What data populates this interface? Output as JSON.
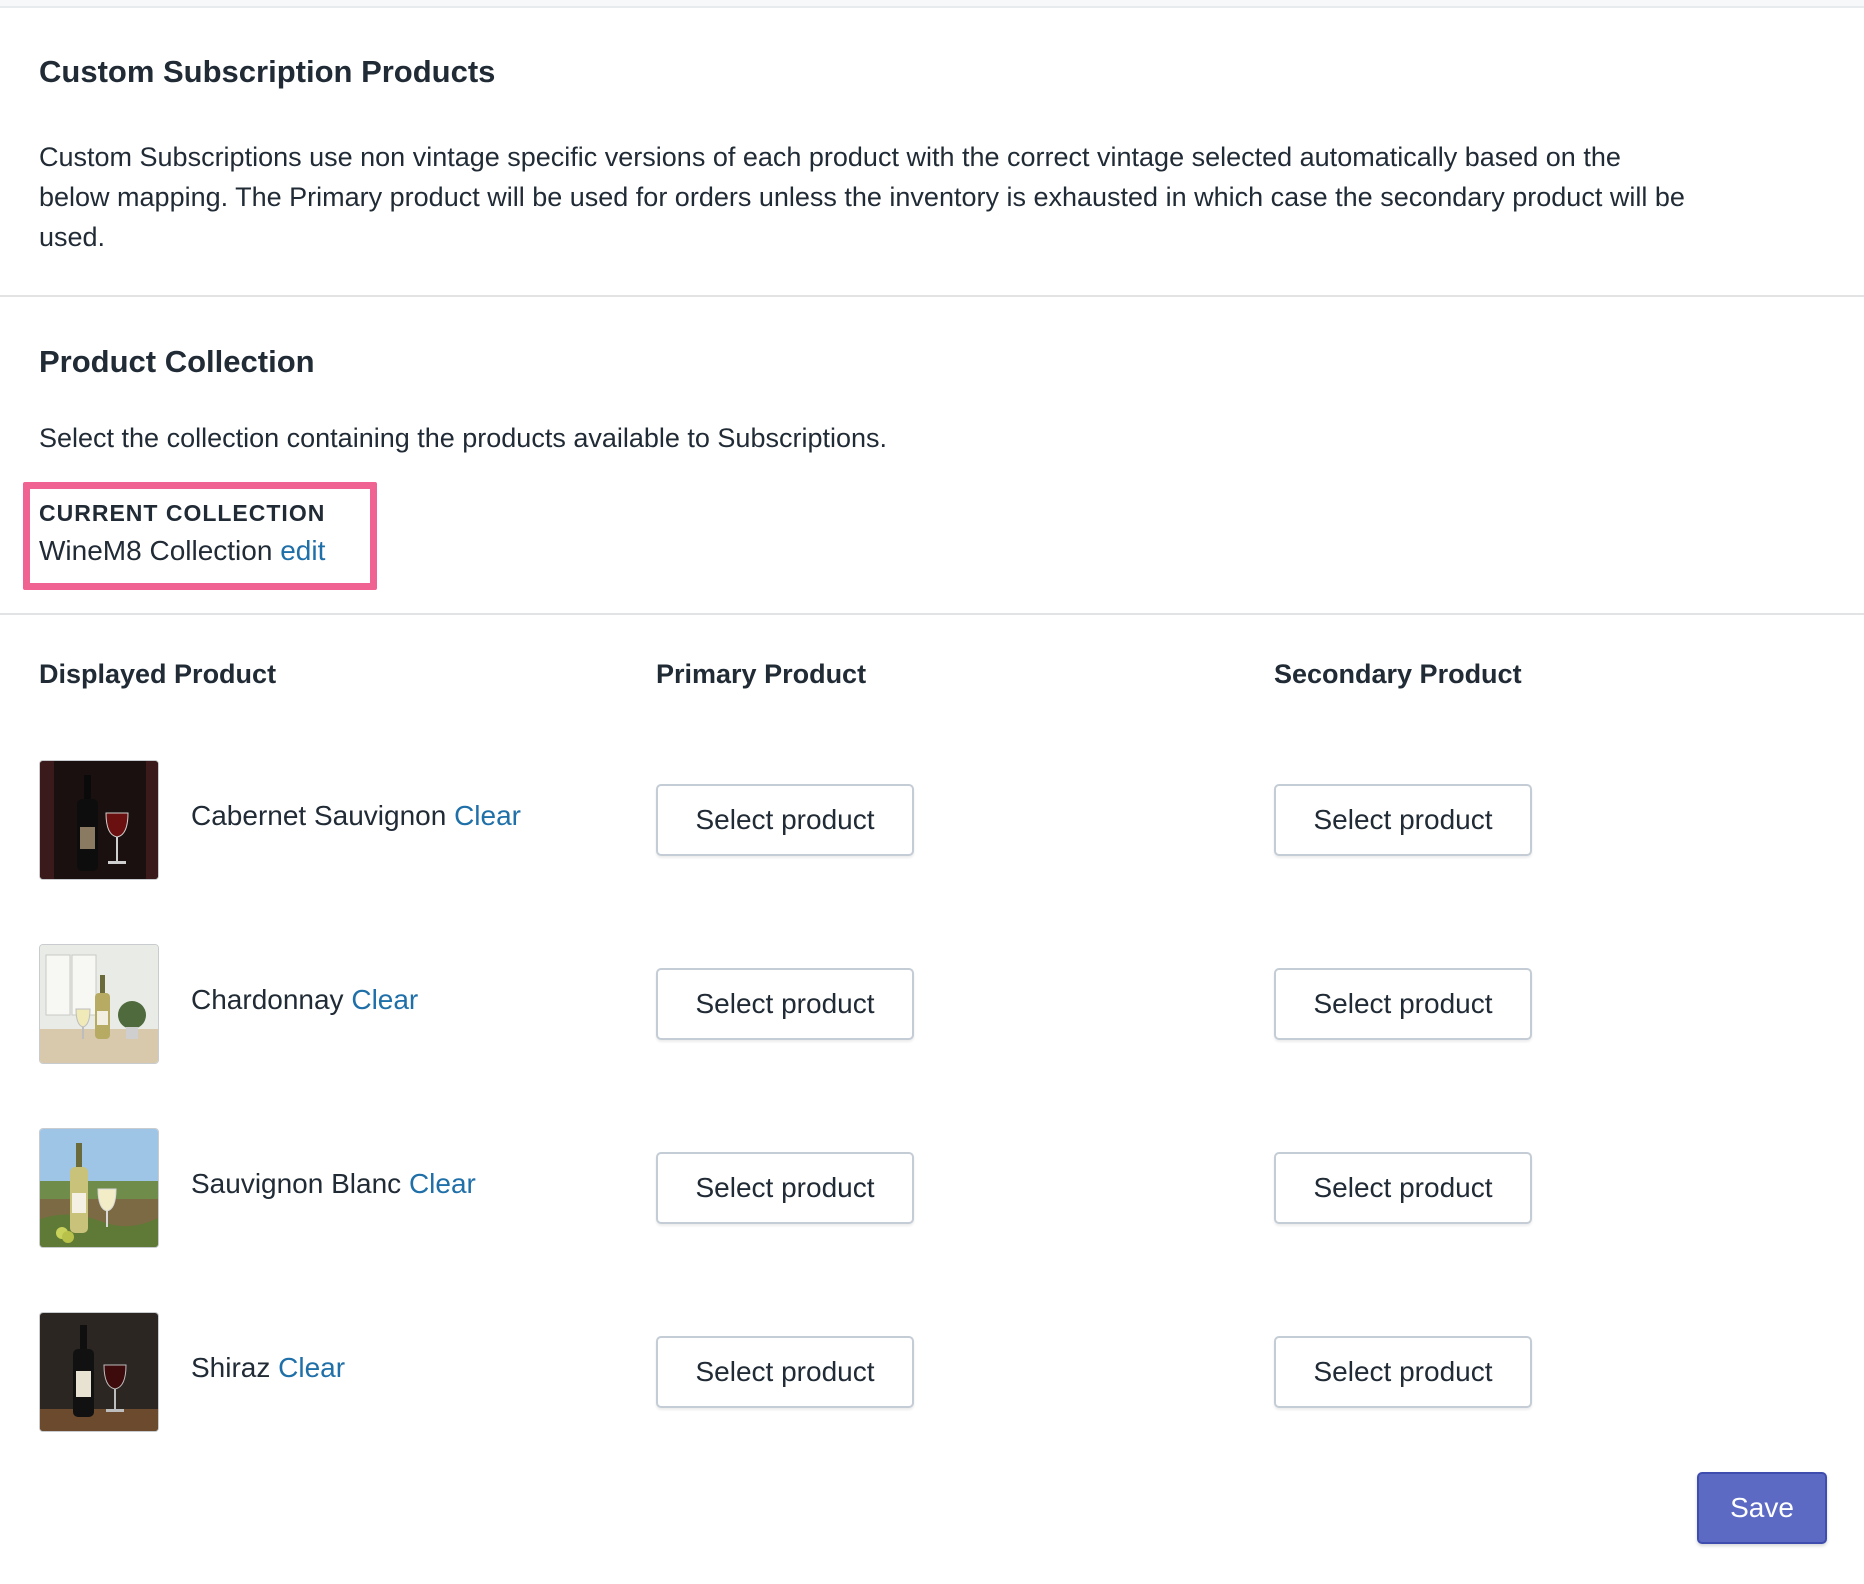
{
  "subscription_section": {
    "title": "Custom Subscription Products",
    "description_line1": "Custom Subscriptions use non vintage specific versions of each product with the correct vintage selected automatically based on the",
    "description_line2": "below mapping. The Primary product will be used for orders unless the inventory is exhausted in which case the secondary product will be",
    "description_line3": "used."
  },
  "collection_section": {
    "title": "Product Collection",
    "description": "Select the collection containing the products available to Subscriptions.",
    "current_label": "CURRENT COLLECTION",
    "current_value": "WineM8 Collection",
    "edit_label": "edit"
  },
  "mapping_table": {
    "headers": {
      "displayed": "Displayed Product",
      "primary": "Primary Product",
      "secondary": "Secondary Product"
    },
    "rows": [
      {
        "name": "Cabernet Sauvignon",
        "clear_label": "Clear",
        "primary_label": "Select product",
        "secondary_label": "Select product"
      },
      {
        "name": "Chardonnay",
        "clear_label": "Clear",
        "primary_label": "Select product",
        "secondary_label": "Select product"
      },
      {
        "name": "Sauvignon Blanc",
        "clear_label": "Clear",
        "primary_label": "Select product",
        "secondary_label": "Select product"
      },
      {
        "name": "Shiraz",
        "clear_label": "Clear",
        "primary_label": "Select product",
        "secondary_label": "Select product"
      }
    ]
  },
  "footer": {
    "save_label": "Save"
  },
  "colors": {
    "link": "#1f6fa8",
    "save_button": "#5c6ac4",
    "highlight": "#f06292"
  }
}
